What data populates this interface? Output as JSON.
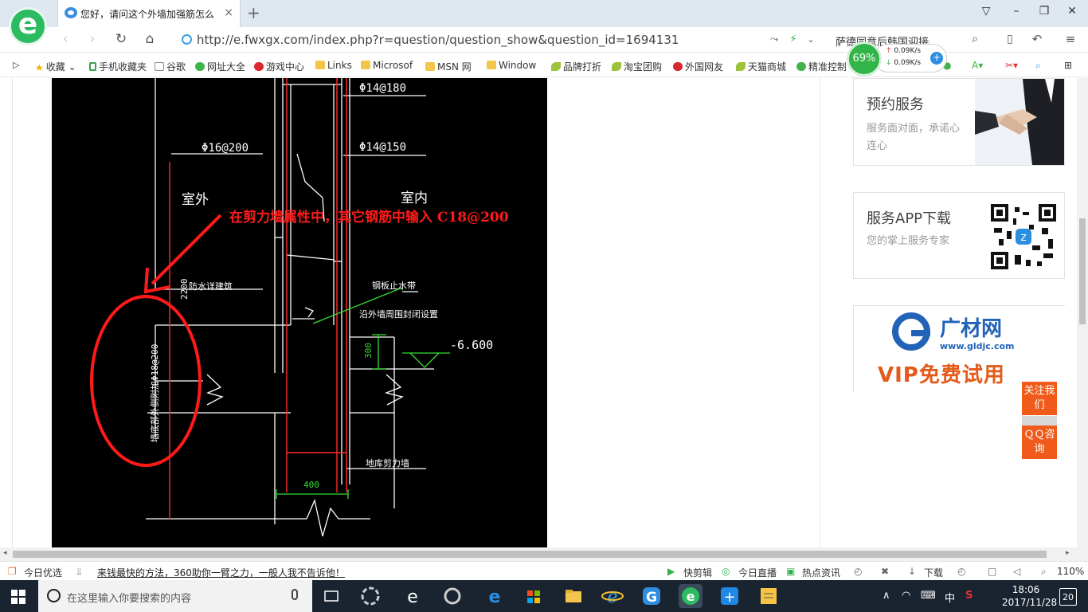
{
  "browser": {
    "tab_title": "您好，请问这个外墙加强筋怎么",
    "tab_close": "×",
    "new_tab": "+",
    "url": "http://e.fwxgx.com/index.php?r=question/question_show&question_id=1694131",
    "search_text": "萨德同意后韩国迎接春"
  },
  "bookmarks": [
    {
      "label": "收藏",
      "icon": "star"
    },
    {
      "label": "手机收藏夹",
      "icon": "phone"
    },
    {
      "label": "谷歌",
      "icon": "doc"
    },
    {
      "label": "网址大全",
      "icon": "green"
    },
    {
      "label": "游戏中心",
      "icon": "red"
    },
    {
      "label": "Links",
      "icon": "folder"
    },
    {
      "label": "Microsof",
      "icon": "folder"
    },
    {
      "label": "MSN 网",
      "icon": "folder"
    },
    {
      "label": "Window",
      "icon": "folder"
    },
    {
      "label": "品牌打折",
      "icon": "leaf"
    },
    {
      "label": "淘宝团购",
      "icon": "leaf"
    },
    {
      "label": "外国网友",
      "icon": "red"
    },
    {
      "label": "天猫商城",
      "icon": "leaf"
    },
    {
      "label": "精准控制",
      "icon": "green"
    }
  ],
  "speed": {
    "percent": "69%",
    "up": "0.09K/s",
    "down": "0.09K/s",
    "plus": "+"
  },
  "drawing": {
    "bar_top": "Φ14@180",
    "bar_left": "Φ16@200",
    "bar_right": "Φ14@150",
    "outside": "室外",
    "inside": "室内",
    "dim_2200": "2200",
    "waterproof": "防水详建筑",
    "waterstop": "钢板止水带",
    "waterstop_note": "沿外墙周围封闭设置",
    "dim_300": "300",
    "elevation": "-6.600",
    "vertical_note": "墙底部外侧附加Φ18@200",
    "shear_wall": "地库剪力墙",
    "dim_400": "400"
  },
  "annotation": "在剪力墙属性中，其它钢筋中输入 C18@200",
  "sidebar": {
    "booking": {
      "title": "预约服务",
      "desc": "服务面对面，承诺心连心"
    },
    "app": {
      "title": "服务APP下载",
      "desc": "您的掌上服务专家"
    },
    "ad": {
      "brand": "广材网",
      "site": "www.gldjc.com",
      "promo": "VIP免费试用"
    },
    "follow": "关注我们",
    "qq": "ＱＱ咨询"
  },
  "status": {
    "daily": "今日优选",
    "news": "来钱最快的方法，360助你一臂之力，一般人我不告诉他！",
    "quick_clip": "快剪辑",
    "live": "今日直播",
    "hot": "热点资讯",
    "download": "下载",
    "zoom": "110%"
  },
  "taskbar": {
    "search_placeholder": "在这里输入你要搜索的内容",
    "ime": "中",
    "time": "18:06",
    "date": "2017/11/28",
    "notifications": "20"
  }
}
